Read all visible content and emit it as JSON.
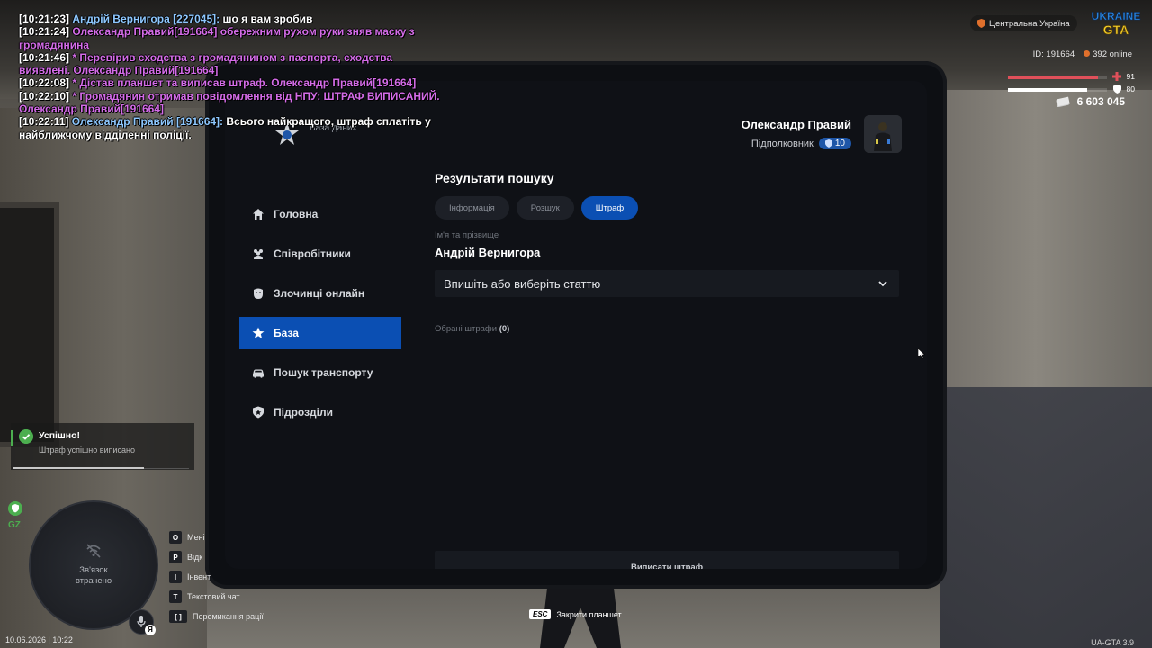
{
  "chat": [
    {
      "ts": "[10:21:23]",
      "name": "Андрій Вернигора [227045]:",
      "msg": " шо я вам зробив",
      "type": "say"
    },
    {
      "ts": "[10:21:24]",
      "text": "Олександр Правий[191664] обережним рухом руки зняв маску з громадянина",
      "type": "me"
    },
    {
      "ts": "[10:21:46]",
      "text": " * Перевірив сходства з громадянином з паспорта, сходства виявлені. Олександр Правий[191664]",
      "type": "do"
    },
    {
      "ts": "[10:22:08]",
      "text": " * Дістав планшет та виписав штраф. Олександр Правий[191664]",
      "type": "do"
    },
    {
      "ts": "[10:22:10]",
      "text": " * Громадянин отримав повідомлення від НПУ: ШТРАФ ВИПИСАНИЙ. Олександр Правий[191664]",
      "type": "do"
    },
    {
      "ts": "[10:22:11]",
      "name": "Олександр Правий [191664]:",
      "msg": " Всього найкращого, штраф сплатіть у найближчому відділенні поліції.",
      "type": "say"
    }
  ],
  "tablet": {
    "app_subtitle": "База даних",
    "profile": {
      "name": "Олександр Правий",
      "rank": "Підполковник",
      "level": "10"
    },
    "sidebar": [
      {
        "label": "Головна",
        "icon": "home-icon",
        "active": false
      },
      {
        "label": "Співробітники",
        "icon": "people-icon",
        "active": false
      },
      {
        "label": "Злочинці онлайн",
        "icon": "mask-icon",
        "active": false
      },
      {
        "label": "База",
        "icon": "star-icon",
        "active": true
      },
      {
        "label": "Пошук транспорту",
        "icon": "car-icon",
        "active": false
      },
      {
        "label": "Підрозділи",
        "icon": "shield-icon",
        "active": false
      }
    ],
    "content": {
      "title": "Результати пошуку",
      "tabs": [
        {
          "label": "Інформація",
          "active": false
        },
        {
          "label": "Розшук",
          "active": false
        },
        {
          "label": "Штраф",
          "active": true
        }
      ],
      "field_label": "Ім'я та прізвище",
      "field_value": "Андрій Вернигора",
      "select_placeholder": "Впишіть або виберіть статтю",
      "chosen_label": "Обрані штрафи",
      "chosen_count": "(0)",
      "submit_label": "Виписати штраф"
    }
  },
  "hud": {
    "region": "Центральна Україна",
    "player_id": "ID: 191664",
    "online": "392 online",
    "health": "91",
    "armor": "80",
    "money": "6 603 045",
    "notification": {
      "title": "Успішно!",
      "text": "Штраф успішно виписано"
    },
    "zone": "GZ",
    "minimap_text_line1": "Зв'язок",
    "minimap_text_line2": "втрачено",
    "lang": "Я",
    "hotkeys": [
      {
        "key": "O",
        "label": "Мені"
      },
      {
        "key": "P",
        "label": "Відк"
      },
      {
        "key": "I",
        "label": "Інвент"
      },
      {
        "key": "T",
        "label": "Текстовий чат"
      },
      {
        "key": "[ ]",
        "label": "Перемикання рації"
      }
    ],
    "esc_key": "ESC",
    "esc_label": "Закрити планшет",
    "datetime": "10.06.2026 | 10:22",
    "version": "UA-GTA 3.9"
  },
  "colors": {
    "accent": "#0b4fb3",
    "success": "#4cae4f",
    "health": "#e0505a",
    "me_text": "#d46ce8",
    "name_text": "#8ec8ff"
  }
}
